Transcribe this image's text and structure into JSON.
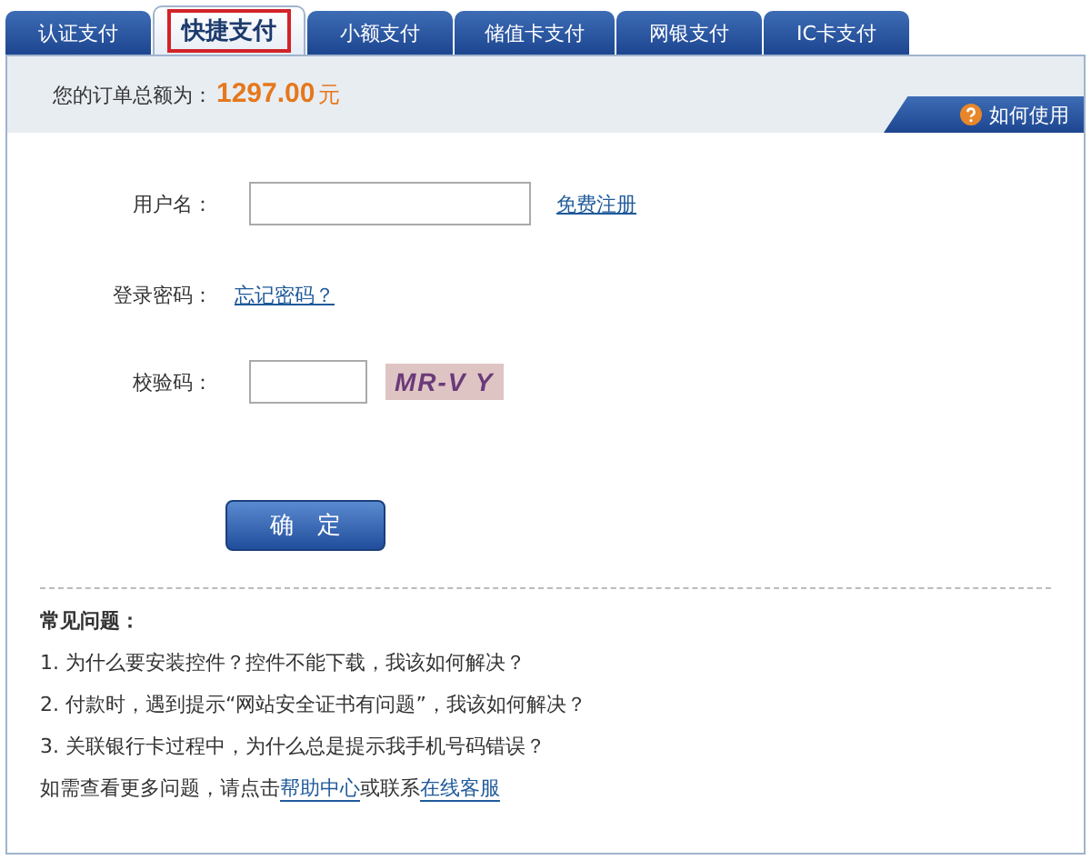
{
  "tabs": [
    {
      "label": "认证支付",
      "selected": false
    },
    {
      "label": "快捷支付",
      "selected": true
    },
    {
      "label": "小额支付",
      "selected": false
    },
    {
      "label": "储值卡支付",
      "selected": false
    },
    {
      "label": "网银支付",
      "selected": false
    },
    {
      "label": "IC卡支付",
      "selected": false
    }
  ],
  "order": {
    "label": "您的订单总额为：",
    "amount": "1297.00",
    "unit": "元"
  },
  "help_tab": {
    "label": "如何使用"
  },
  "form": {
    "username": {
      "label": "用户名：",
      "link": "免费注册"
    },
    "password": {
      "label": "登录密码：",
      "link": "忘记密码？"
    },
    "captcha": {
      "label": "校验码：",
      "code": "MR-V Y"
    },
    "submit": "确　定"
  },
  "faq": {
    "title": "常见问题：",
    "items": [
      "1. 为什么要安装控件？控件不能下载，我该如何解决？",
      "2. 付款时，遇到提示“网站安全证书有问题”，我该如何解决？",
      "3. 关联银行卡过程中，为什么总是提示我手机号码错误？"
    ],
    "more": [
      {
        "kind": "text",
        "text": "如需查看更多问题，请点击"
      },
      {
        "kind": "link",
        "text": "帮助中心"
      },
      {
        "kind": "text",
        "text": "或联系"
      },
      {
        "kind": "link",
        "text": "在线客服"
      }
    ]
  }
}
